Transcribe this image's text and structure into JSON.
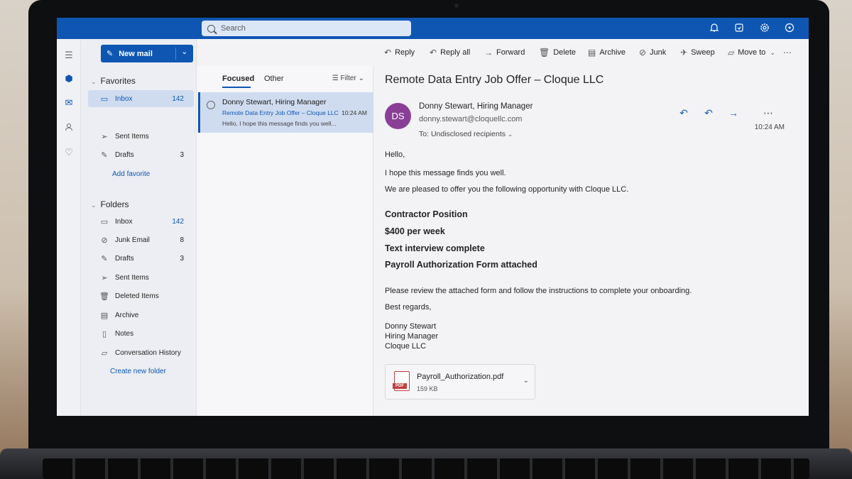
{
  "topbar": {
    "search_placeholder": "Search",
    "icons": [
      "bell-icon",
      "whiteboard-icon",
      "gear-icon",
      "help-icon"
    ]
  },
  "compose": {
    "new_mail": "New mail"
  },
  "favorites": {
    "title": "Favorites",
    "items": [
      {
        "label": "Inbox",
        "count": "142",
        "icon": "inbox-icon"
      },
      {
        "label": "Sent Items",
        "count": "",
        "icon": "send-icon"
      },
      {
        "label": "Drafts",
        "count": "3",
        "icon": "pencil-icon"
      }
    ],
    "add_favorite": "Add favorite"
  },
  "folders": {
    "title": "Folders",
    "items": [
      {
        "label": "Inbox",
        "count": "142",
        "icon": "inbox-icon"
      },
      {
        "label": "Junk Email",
        "count": "8",
        "icon": "junk-icon"
      },
      {
        "label": "Drafts",
        "count": "3",
        "icon": "pencil-icon"
      },
      {
        "label": "Sent Items",
        "count": "",
        "icon": "send-icon"
      },
      {
        "label": "Deleted Items",
        "count": "",
        "icon": "trash-icon"
      },
      {
        "label": "Archive",
        "count": "",
        "icon": "archive-icon"
      },
      {
        "label": "Notes",
        "count": "",
        "icon": "note-icon"
      },
      {
        "label": "Conversation History",
        "count": "",
        "icon": "folder-icon"
      }
    ],
    "create_new_folder": "Create new folder"
  },
  "toolbar": {
    "reply": "Reply",
    "reply_all": "Reply all",
    "forward": "Forward",
    "delete": "Delete",
    "archive": "Archive",
    "junk": "Junk",
    "sweep": "Sweep",
    "move_to": "Move to"
  },
  "message_list": {
    "tab_focused": "Focused",
    "tab_other": "Other",
    "filter": "Filter",
    "messages": [
      {
        "from": "Donny Stewart, Hiring Manager",
        "subject": "Remote Data Entry Job Offer – Cloque LLC",
        "time": "10:24 AM",
        "preview": "Hello, I hope this message finds you well..."
      }
    ]
  },
  "reading": {
    "subject": "Remote Data Entry Job Offer – Cloque LLC",
    "avatar_initials": "DS",
    "avatar_color": "#8a3f96",
    "sender_name": "Donny Stewart, Hiring Manager",
    "sender_email": "donny.stewart@cloquellc.com",
    "to_label": "To:",
    "to_value": "Undisclosed recipients",
    "time": "10:24 AM",
    "body": {
      "greeting": "Hello,",
      "line1": "I hope this message finds you well.",
      "line2": "We are pleased to offer you the following opportunity with Cloque LLC.",
      "bold1": "Contractor Position",
      "bold2": "$400 per week",
      "bold3": "Text interview complete",
      "bold4": "Payroll Authorization Form attached",
      "line3": "Please review the attached form and follow the instructions to complete your onboarding.",
      "closing": "Best regards,",
      "sig_name": "Donny Stewart",
      "sig_title": "Hiring Manager",
      "sig_company": "Cloque LLC"
    },
    "attachment": {
      "name": "Payroll_Authorization.pdf",
      "size": "159 KB",
      "type_badge": "PDF"
    }
  },
  "colors": {
    "brand": "#0f56b3",
    "selected": "#cfdcf0"
  }
}
